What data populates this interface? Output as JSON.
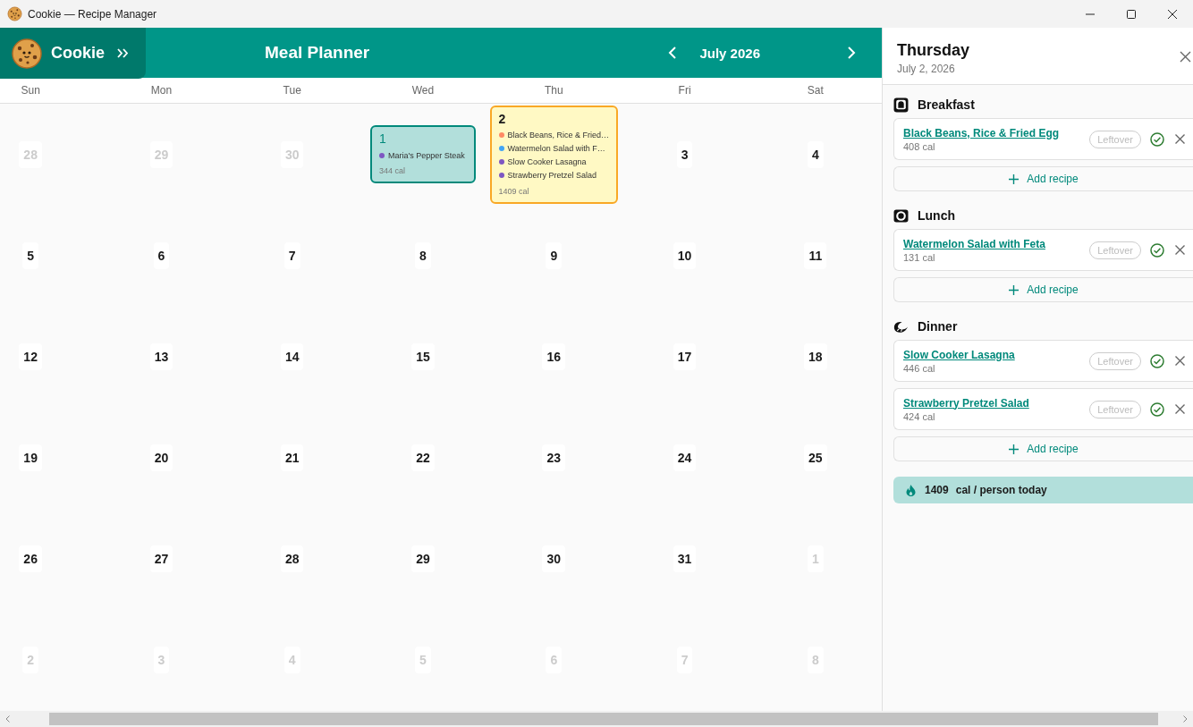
{
  "window": {
    "title": "Cookie — Recipe Manager"
  },
  "header": {
    "brand": "Cookie",
    "title": "Meal Planner",
    "month": "July 2026"
  },
  "calendar": {
    "weekdays": [
      "Sun",
      "Mon",
      "Tue",
      "Wed",
      "Thu",
      "Fri",
      "Sat"
    ],
    "weeks": [
      [
        {
          "day": "28",
          "outside_month": true,
          "today": false,
          "selected": false
        },
        {
          "day": "29",
          "outside_month": true,
          "today": false,
          "selected": false
        },
        {
          "day": "30",
          "outside_month": true,
          "today": false,
          "selected": false
        },
        {
          "day": "1",
          "outside_month": false,
          "today": true,
          "selected": false,
          "meals": [
            {
              "name": "Maria's Pepper Steak",
              "color": "#7e57c2"
            }
          ],
          "calories": "344 cal"
        },
        {
          "day": "2",
          "outside_month": false,
          "today": false,
          "selected": true,
          "meals": [
            {
              "name": "Black Beans, Rice & Fried…",
              "color": "#ff8a65"
            },
            {
              "name": "Watermelon Salad with F…",
              "color": "#42a5f5"
            },
            {
              "name": "Slow Cooker Lasagna",
              "color": "#7e57c2"
            },
            {
              "name": "Strawberry Pretzel Salad",
              "color": "#7e57c2"
            }
          ],
          "calories": "1409 cal"
        },
        {
          "day": "3",
          "outside_month": false,
          "today": false,
          "selected": false
        },
        {
          "day": "4",
          "outside_month": false,
          "today": false,
          "selected": false
        }
      ],
      [
        {
          "day": "5",
          "outside_month": false,
          "today": false,
          "selected": false
        },
        {
          "day": "6",
          "outside_month": false,
          "today": false,
          "selected": false
        },
        {
          "day": "7",
          "outside_month": false,
          "today": false,
          "selected": false
        },
        {
          "day": "8",
          "outside_month": false,
          "today": false,
          "selected": false
        },
        {
          "day": "9",
          "outside_month": false,
          "today": false,
          "selected": false
        },
        {
          "day": "10",
          "outside_month": false,
          "today": false,
          "selected": false
        },
        {
          "day": "11",
          "outside_month": false,
          "today": false,
          "selected": false
        }
      ],
      [
        {
          "day": "12",
          "outside_month": false,
          "today": false,
          "selected": false
        },
        {
          "day": "13",
          "outside_month": false,
          "today": false,
          "selected": false
        },
        {
          "day": "14",
          "outside_month": false,
          "today": false,
          "selected": false
        },
        {
          "day": "15",
          "outside_month": false,
          "today": false,
          "selected": false
        },
        {
          "day": "16",
          "outside_month": false,
          "today": false,
          "selected": false
        },
        {
          "day": "17",
          "outside_month": false,
          "today": false,
          "selected": false
        },
        {
          "day": "18",
          "outside_month": false,
          "today": false,
          "selected": false
        }
      ],
      [
        {
          "day": "19",
          "outside_month": false,
          "today": false,
          "selected": false
        },
        {
          "day": "20",
          "outside_month": false,
          "today": false,
          "selected": false
        },
        {
          "day": "21",
          "outside_month": false,
          "today": false,
          "selected": false
        },
        {
          "day": "22",
          "outside_month": false,
          "today": false,
          "selected": false
        },
        {
          "day": "23",
          "outside_month": false,
          "today": false,
          "selected": false
        },
        {
          "day": "24",
          "outside_month": false,
          "today": false,
          "selected": false
        },
        {
          "day": "25",
          "outside_month": false,
          "today": false,
          "selected": false
        }
      ],
      [
        {
          "day": "26",
          "outside_month": false,
          "today": false,
          "selected": false
        },
        {
          "day": "27",
          "outside_month": false,
          "today": false,
          "selected": false
        },
        {
          "day": "28",
          "outside_month": false,
          "today": false,
          "selected": false
        },
        {
          "day": "29",
          "outside_month": false,
          "today": false,
          "selected": false
        },
        {
          "day": "30",
          "outside_month": false,
          "today": false,
          "selected": false
        },
        {
          "day": "31",
          "outside_month": false,
          "today": false,
          "selected": false
        },
        {
          "day": "1",
          "outside_month": true,
          "today": false,
          "selected": false
        }
      ],
      [
        {
          "day": "2",
          "outside_month": true,
          "today": false,
          "selected": false
        },
        {
          "day": "3",
          "outside_month": true,
          "today": false,
          "selected": false
        },
        {
          "day": "4",
          "outside_month": true,
          "today": false,
          "selected": false
        },
        {
          "day": "5",
          "outside_month": true,
          "today": false,
          "selected": false
        },
        {
          "day": "6",
          "outside_month": true,
          "today": false,
          "selected": false
        },
        {
          "day": "7",
          "outside_month": true,
          "today": false,
          "selected": false
        },
        {
          "day": "8",
          "outside_month": true,
          "today": false,
          "selected": false
        }
      ]
    ]
  },
  "day_panel": {
    "weekday": "Thursday",
    "date": "July 2, 2026",
    "sections": [
      {
        "kind": "breakfast",
        "title": "Breakfast",
        "add_label": "Add recipe",
        "recipes": [
          {
            "name": "Black Beans, Rice & Fried Egg",
            "calories": "408 cal",
            "leftover_label": "Leftover",
            "leftover": false
          }
        ]
      },
      {
        "kind": "lunch",
        "title": "Lunch",
        "add_label": "Add recipe",
        "recipes": [
          {
            "name": "Watermelon Salad with Feta",
            "calories": "131 cal",
            "leftover_label": "Leftover",
            "leftover": false
          }
        ]
      },
      {
        "kind": "dinner",
        "title": "Dinner",
        "add_label": "Add recipe",
        "recipes": [
          {
            "name": "Slow Cooker Lasagna",
            "calories": "446 cal",
            "leftover_label": "Leftover",
            "leftover": false
          },
          {
            "name": "Strawberry Pretzel Salad",
            "calories": "424 cal",
            "leftover_label": "Leftover",
            "leftover": false
          }
        ]
      }
    ],
    "total": {
      "value": "1409",
      "label": "cal / person today"
    }
  }
}
